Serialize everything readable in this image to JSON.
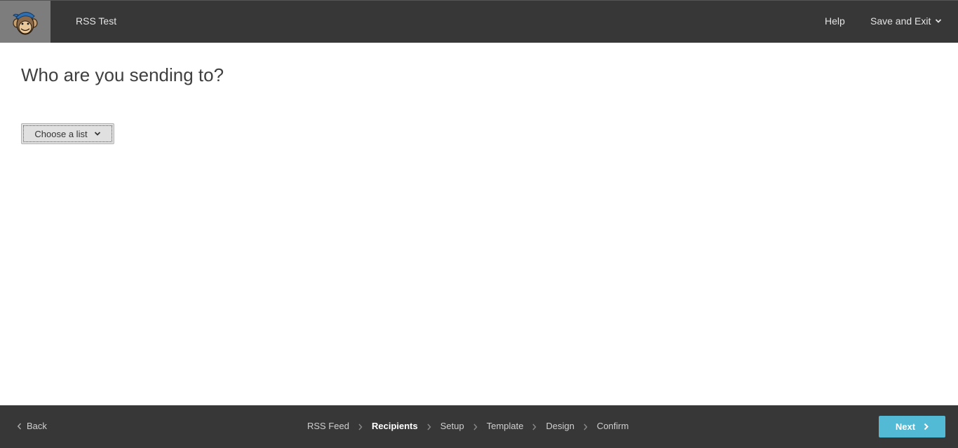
{
  "header": {
    "campaign_title": "RSS Test",
    "help_label": "Help",
    "save_exit_label": "Save and Exit",
    "logo_icon": "mailchimp-monkey-logo"
  },
  "main": {
    "heading": "Who are you sending to?",
    "list_dropdown_label": "Choose a list"
  },
  "footer": {
    "back_label": "Back",
    "steps": [
      {
        "label": "RSS Feed",
        "active": false
      },
      {
        "label": "Recipients",
        "active": true
      },
      {
        "label": "Setup",
        "active": false
      },
      {
        "label": "Template",
        "active": false
      },
      {
        "label": "Design",
        "active": false
      },
      {
        "label": "Confirm",
        "active": false
      }
    ],
    "next_label": "Next"
  },
  "colors": {
    "bar_background": "#373737",
    "logo_background": "#7d7d7d",
    "next_button": "#52bad5",
    "heading_text": "#3f3f3f"
  }
}
